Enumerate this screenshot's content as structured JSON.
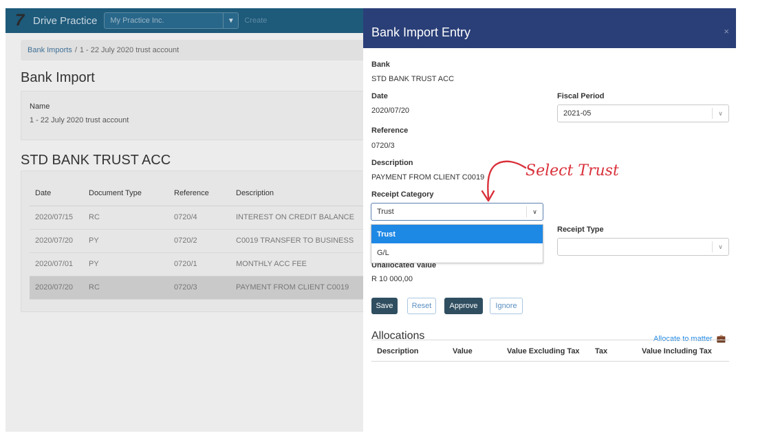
{
  "app": {
    "brand": "Drive Practice",
    "company": "My Practice Inc.",
    "create_label": "Create",
    "breadcrumb_link": "Bank Imports",
    "breadcrumb_sep": "/",
    "breadcrumb_current": "1 - 22 July 2020 trust account",
    "page_title": "Bank Import",
    "name_label": "Name",
    "name_value": "1 - 22 July 2020 trust account",
    "bank_heading": "STD BANK TRUST ACC",
    "table": {
      "headers": [
        "Date",
        "Document Type",
        "Reference",
        "Description"
      ],
      "rows": [
        [
          "2020/07/15",
          "RC",
          "0720/4",
          "INTEREST ON CREDIT BALANCE"
        ],
        [
          "2020/07/20",
          "PY",
          "0720/2",
          "C0019 TRANSFER TO BUSINESS"
        ],
        [
          "2020/07/01",
          "PY",
          "0720/1",
          "MONTHLY ACC FEE"
        ],
        [
          "2020/07/20",
          "RC",
          "0720/3",
          "PAYMENT FROM CLIENT C0019"
        ]
      ]
    }
  },
  "modal": {
    "title": "Bank Import Entry",
    "close": "×",
    "bank_label": "Bank",
    "bank_value": "STD BANK TRUST ACC",
    "date_label": "Date",
    "date_value": "2020/07/20",
    "fiscal_label": "Fiscal Period",
    "fiscal_value": "2021-05",
    "reference_label": "Reference",
    "reference_value": "0720/3",
    "description_label": "Description",
    "description_value": "PAYMENT FROM CLIENT C0019",
    "receipt_category_label": "Receipt Category",
    "receipt_category_value": "Trust",
    "receipt_category_options": [
      "Trust",
      "G/L"
    ],
    "receipt_type_label": "Receipt Type",
    "receipt_type_value": "",
    "unallocated_label": "Unallocated Value",
    "unallocated_value": "R 10 000,00",
    "buttons": {
      "save": "Save",
      "reset": "Reset",
      "approve": "Approve",
      "ignore": "Ignore"
    },
    "allocations_title": "Allocations",
    "allocate_link": "Allocate to matter",
    "alloc_headers": [
      "Description",
      "Value",
      "Value Excluding Tax",
      "Tax",
      "Value Including Tax"
    ]
  },
  "annotation": {
    "text": "Select Trust",
    "color": "#d9303a"
  },
  "colors": {
    "topbar": "#1e5a7a",
    "modal_header": "#2a3f78",
    "accent": "#1e88e5",
    "dark_button": "#2f4e60"
  }
}
